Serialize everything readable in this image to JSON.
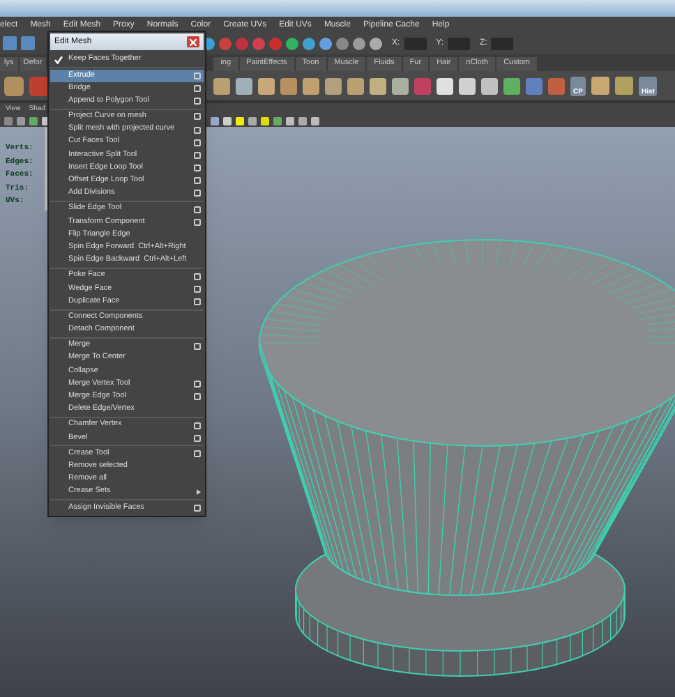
{
  "menubar": {
    "items": [
      "elect",
      "Mesh",
      "Edit Mesh",
      "Proxy",
      "Normals",
      "Color",
      "Create UVs",
      "Edit UVs",
      "Muscle",
      "Pipeline Cache",
      "Help"
    ]
  },
  "toolbar": {
    "fields": [
      {
        "label": "X:"
      },
      {
        "label": "Y:"
      },
      {
        "label": "Z:"
      }
    ]
  },
  "shelf": {
    "tabs_left": [
      "lys",
      "Defor"
    ],
    "tabs": [
      "ing",
      "PaintEffects",
      "Toon",
      "Muscle",
      "Fluids",
      "Fur",
      "Hair",
      "nCloth",
      "Custom"
    ],
    "icon_labels": [
      "CP",
      "Hist"
    ]
  },
  "panel": {
    "menu": [
      "View",
      "Shad"
    ],
    "hud": [
      "Verts:",
      "Edges:",
      "Faces:",
      "Tris:",
      "UVs:"
    ]
  },
  "edit_mesh_menu": {
    "title": "Edit Mesh",
    "groups": [
      [
        {
          "label": "Keep Faces Together",
          "kind": "check",
          "checked": true,
          "selected": false
        }
      ],
      [
        {
          "label": "Extrude",
          "kind": "option",
          "selected": true
        },
        {
          "label": "Bridge",
          "kind": "option",
          "selected": false
        },
        {
          "label": "Append to Polygon Tool",
          "kind": "option",
          "selected": false
        }
      ],
      [
        {
          "label": "Project Curve on mesh",
          "kind": "option",
          "selected": false
        },
        {
          "label": "Split mesh with projected curve",
          "kind": "option",
          "selected": false
        },
        {
          "label": "Cut Faces Tool",
          "kind": "option",
          "selected": false
        },
        {
          "label": "Interactive Split Tool",
          "kind": "option",
          "selected": false
        },
        {
          "label": "Insert Edge Loop Tool",
          "kind": "option",
          "selected": false
        },
        {
          "label": "Offset Edge Loop Tool",
          "kind": "option",
          "selected": false
        },
        {
          "label": "Add Divisions",
          "kind": "option",
          "selected": false
        }
      ],
      [
        {
          "label": "Slide Edge Tool",
          "kind": "option",
          "selected": false
        },
        {
          "label": "Transform Component",
          "kind": "option",
          "selected": false
        },
        {
          "label": "Flip Triangle Edge",
          "kind": "plain",
          "selected": false
        },
        {
          "label": "Spin Edge Forward",
          "kind": "shortcut",
          "shortcut": "Ctrl+Alt+Right",
          "selected": false
        },
        {
          "label": "Spin Edge Backward",
          "kind": "shortcut",
          "shortcut": "Ctrl+Alt+Left",
          "selected": false
        }
      ],
      [
        {
          "label": "Poke Face",
          "kind": "option",
          "selected": false
        },
        {
          "label": "Wedge Face",
          "kind": "option",
          "selected": false
        },
        {
          "label": "Duplicate Face",
          "kind": "option",
          "selected": false
        }
      ],
      [
        {
          "label": "Connect Components",
          "kind": "plain",
          "selected": false
        },
        {
          "label": "Detach Component",
          "kind": "plain",
          "selected": false
        }
      ],
      [
        {
          "label": "Merge",
          "kind": "option",
          "selected": false
        },
        {
          "label": "Merge To Center",
          "kind": "plain",
          "selected": false
        },
        {
          "label": "Collapse",
          "kind": "plain",
          "selected": false
        },
        {
          "label": "Merge Vertex Tool",
          "kind": "option",
          "selected": false
        },
        {
          "label": "Merge Edge Tool",
          "kind": "option",
          "selected": false
        },
        {
          "label": "Delete Edge/Vertex",
          "kind": "plain",
          "selected": false
        }
      ],
      [
        {
          "label": "Chamfer Vertex",
          "kind": "option",
          "selected": false
        },
        {
          "label": "Bevel",
          "kind": "option",
          "selected": false
        }
      ],
      [
        {
          "label": "Crease Tool",
          "kind": "option",
          "selected": false
        },
        {
          "label": "Remove selected",
          "kind": "plain",
          "selected": false
        },
        {
          "label": "Remove all",
          "kind": "plain",
          "selected": false
        },
        {
          "label": "Crease Sets",
          "kind": "submenu",
          "selected": false
        }
      ],
      [
        {
          "label": "Assign Invisible Faces",
          "kind": "option",
          "selected": false
        }
      ]
    ]
  }
}
